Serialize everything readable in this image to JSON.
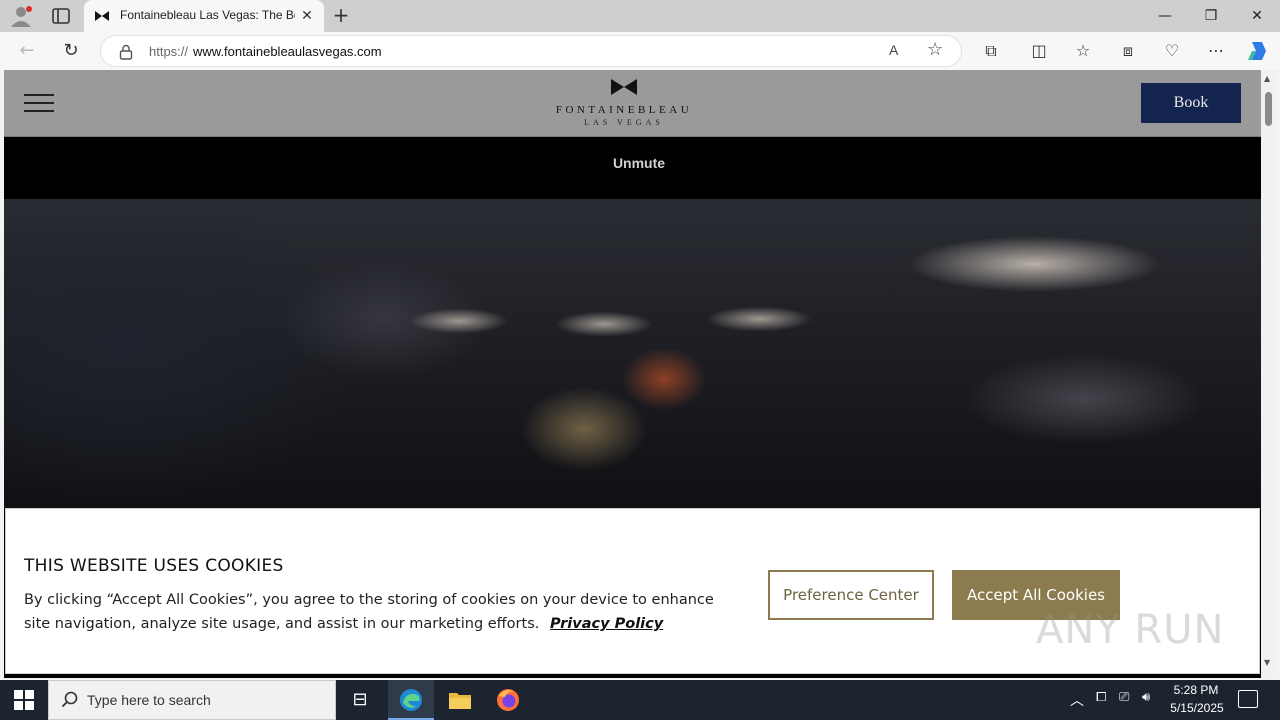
{
  "browser": {
    "tab_title": "Fontainebleau Las Vegas: The Best",
    "tab_close": "✕",
    "new_tab": "+",
    "url_prefix": "https://",
    "url_domain": "www.fontainebleaulasvegas.com",
    "window_controls": {
      "minimize": "—",
      "restore": "❐",
      "close": "✕"
    },
    "readaloud_label": "A",
    "accent_color": "#1b6fd1"
  },
  "site": {
    "logo_name": "FONTAINEBLEAU",
    "logo_sub": "LAS VEGAS",
    "book_label": "Book",
    "unmute_label": "Unmute",
    "header_color": "#9a9a9a",
    "book_color": "#13254f"
  },
  "cookie_banner": {
    "title": "THIS WEBSITE USES COOKIES",
    "body": "By clicking “Accept All Cookies”, you agree to the storing of cookies on your device to enhance site navigation, analyze site usage, and assist in our marketing efforts.",
    "privacy_link": "Privacy Policy",
    "preference_label": "Preference Center",
    "accept_label": "Accept All Cookies",
    "button_color": "#8c7b4e"
  },
  "watermark": "ANY RUN",
  "taskbar": {
    "search_placeholder": "Type here to search",
    "time": "5:28 PM",
    "date": "5/15/2025"
  }
}
